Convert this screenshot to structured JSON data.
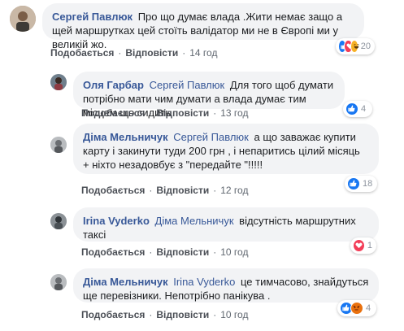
{
  "comments": [
    {
      "author": "Сергей Павлюк",
      "mention": "",
      "text": "Про що думає влада .Жити немає защо а щей маршрутках цей стоїть валідатор ми не в Європі ми у великій жо.",
      "like": "Подобається",
      "reply": "Відповісти",
      "time": "14 год",
      "reactions": [
        "like",
        "love",
        "haha"
      ],
      "count": "20"
    },
    {
      "author": "Оля Гарбар",
      "mention": "Сергей Павлюк",
      "text": "Для того щоб думати потрібно мати чим думати а влада думає тим місцем що сидить",
      "like": "Подобається",
      "reply": "Відповісти",
      "time": "13 год",
      "reactions": [
        "like"
      ],
      "count": "4"
    },
    {
      "author": "Діма Мельничук",
      "mention": "Сергей Павлюк",
      "text": "а що заважає купити карту і закинути туди 200 грн , і непаритись цілий місяць + ніхто незадовбує з \"передайте \"!!!!!",
      "like": "Подобається",
      "reply": "Відповісти",
      "time": "12 год",
      "reactions": [
        "like"
      ],
      "count": "18"
    },
    {
      "author": "Irina Vyderko",
      "mention": "Діма Мельничук",
      "text": "відсутність маршрутних таксі",
      "like": "Подобається",
      "reply": "Відповісти",
      "time": "10 год",
      "reactions": [
        "love"
      ],
      "count": "1"
    },
    {
      "author": "Діма Мельничук",
      "mention": "Irina Vyderko",
      "text": "це тимчасово, знайдуться ще перевізники. Непотрібно панікува .",
      "like": "Подобається",
      "reply": "Відповісти",
      "time": "10 год",
      "reactions": [
        "like",
        "angry"
      ],
      "count": "4"
    }
  ],
  "colors": {
    "link": "#385898",
    "bubble": "#f2f3f5",
    "like": "#1877f2",
    "love": "#f33e58",
    "haha": "#f7b125",
    "angry": "#e9710f"
  },
  "icons": {
    "like": "thumbs-up-icon",
    "love": "heart-icon",
    "haha": "laughing-face-icon",
    "angry": "angry-face-icon"
  }
}
